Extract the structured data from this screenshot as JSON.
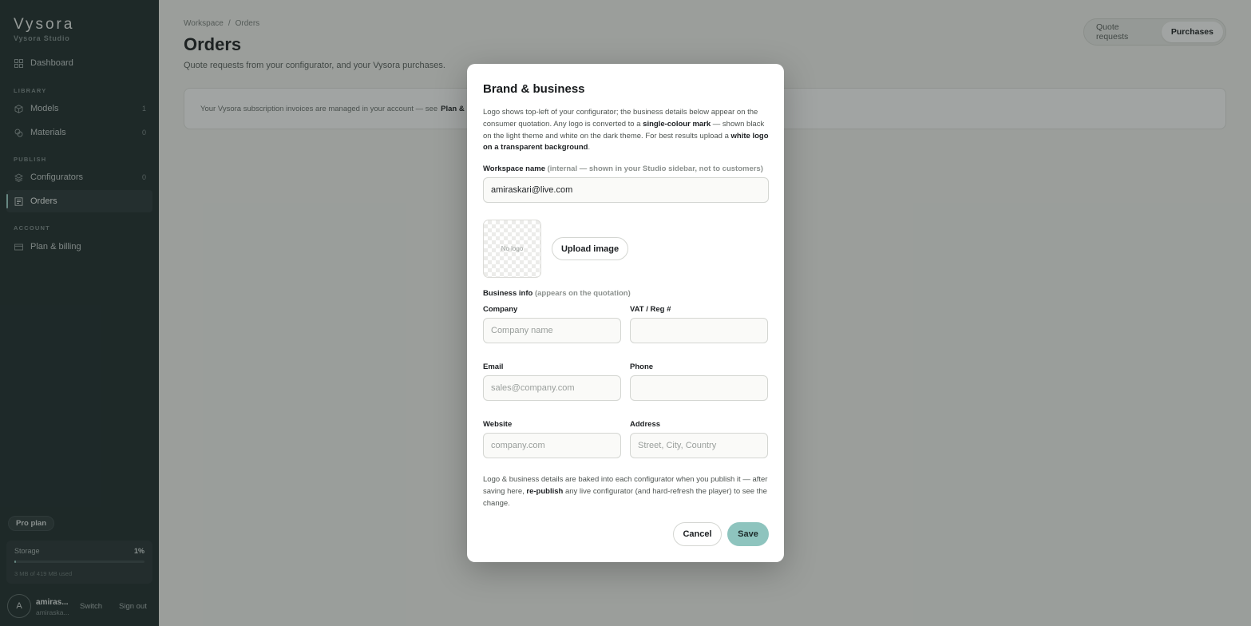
{
  "sidebar": {
    "brand": "Vysora",
    "brand_sub": "Vysora Studio",
    "dashboard": "Dashboard",
    "library_label": "LIBRARY",
    "models": {
      "label": "Models",
      "count": "1"
    },
    "materials": {
      "label": "Materials",
      "count": "0"
    },
    "publish_label": "PUBLISH",
    "configurators": {
      "label": "Configurators",
      "count": "0"
    },
    "orders": "Orders",
    "account_label": "ACCOUNT",
    "billing": "Plan & billing",
    "plan": "Pro plan",
    "storage": {
      "label": "Storage",
      "percent": "1%",
      "used": "3 MB of 419 MB used",
      "fill": 0.01
    },
    "user": {
      "initial": "A",
      "name": "amiras...",
      "email": "amiraska...",
      "switch": "Switch",
      "signout": "Sign out"
    }
  },
  "main": {
    "breadcrumb": [
      "Workspace",
      "Orders"
    ],
    "title": "Orders",
    "subtitle": "Quote requests from your configurator, and your Vysora purchases.",
    "tabs": [
      "Quote requests",
      "Purchases"
    ],
    "active_tab": "Purchases",
    "notice_text": "Your Vysora subscription invoices are managed in your account — see",
    "notice_link": "Plan & billi"
  },
  "modal": {
    "title": "Brand & business",
    "desc_1": "Logo shows top-left of your configurator; the business details below appear on the consumer quotation. Any logo is converted to a ",
    "desc_bold_1": "single-colour mark",
    "desc_2": " — shown black on the light theme and white on the dark theme. For best results upload a ",
    "desc_bold_2": "white logo on a transparent background",
    "desc_3": ".",
    "workspace_label": "Workspace name",
    "workspace_hint": "(internal — shown in your Studio sidebar, not to customers)",
    "workspace_value": "amiraskari@live.com",
    "no_logo": "No logo",
    "upload": "Upload image",
    "business_label": "Business info",
    "business_hint": "(appears on the quotation)",
    "company_label": "Company",
    "company_placeholder": "Company name",
    "vat_label": "VAT / Reg #",
    "email_label": "Email",
    "email_placeholder": "sales@company.com",
    "phone_label": "Phone",
    "website_label": "Website",
    "website_placeholder": "company.com",
    "address_label": "Address",
    "address_placeholder": "Street, City, Country",
    "foot_1": "Logo & business details are baked into each configurator when you publish it — after saving here, ",
    "foot_bold": "re-publish",
    "foot_2": " any live configurator (and hard-refresh the player) to see the change.",
    "cancel": "Cancel",
    "save": "Save"
  },
  "colors": {
    "sidebar_bg": "#1e2b2c",
    "accent": "#9ccfc7",
    "save_bg": "#8ec4be"
  }
}
